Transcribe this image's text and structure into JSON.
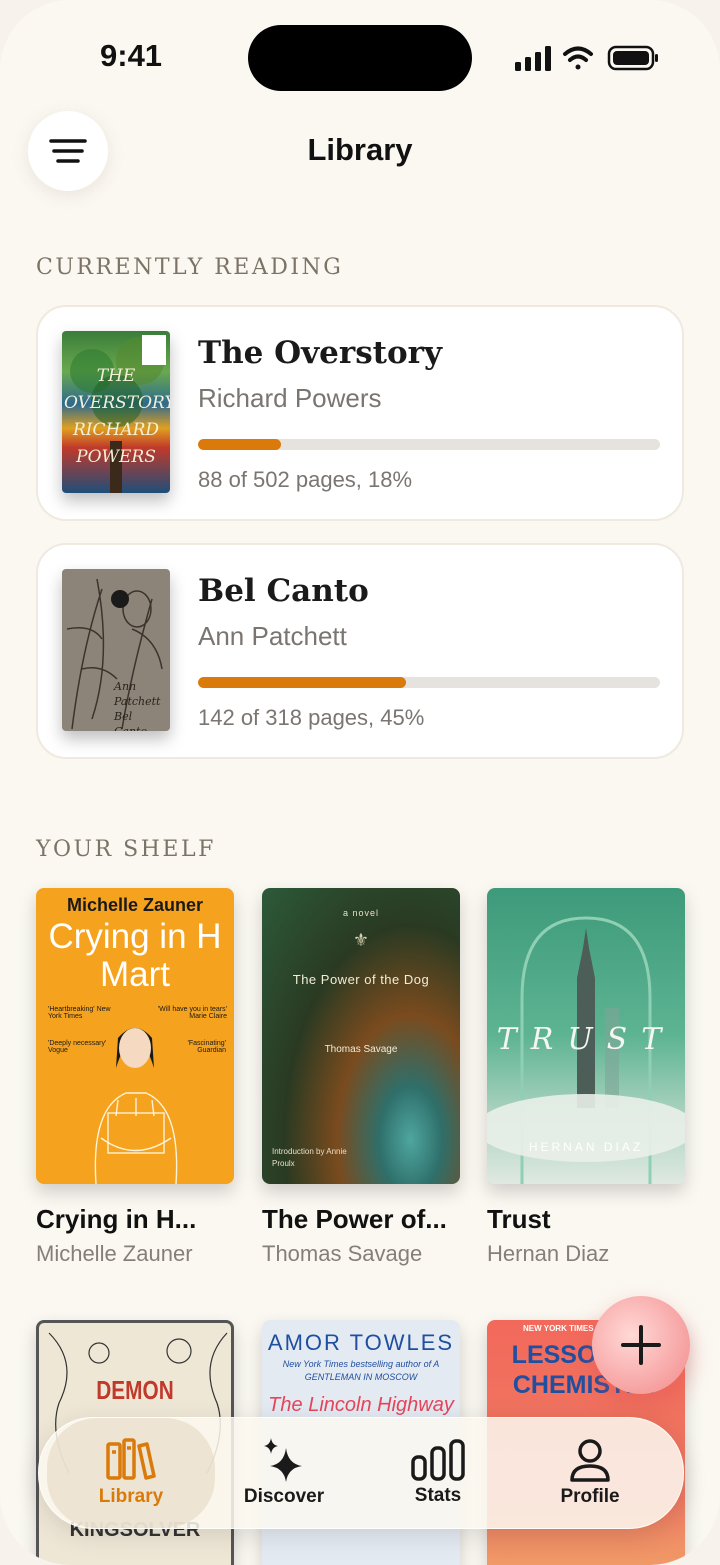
{
  "status": {
    "time": "9:41"
  },
  "header": {
    "title": "Library",
    "menu_icon": "hamburger-icon"
  },
  "currently_reading": {
    "label": "CURRENTLY READING",
    "books": [
      {
        "title": "The Overstory",
        "author": "Richard Powers",
        "progress": 0.18,
        "pages": "88 of 502 pages, 18%",
        "cover_text": "THE OVERSTORY RICHARD POWERS"
      },
      {
        "title": "Bel Canto",
        "author": "Ann Patchett",
        "progress": 0.45,
        "pages": "142 of 318 pages, 45%",
        "cover_text": "Ann Patchett Bel Canto"
      }
    ]
  },
  "shelf": {
    "label": "YOUR SHELF",
    "books": [
      {
        "title": "Crying in H...",
        "author": "Michelle Zauner",
        "cover_author": "Michelle Zauner",
        "cover_title": "Crying in H Mart",
        "cover_quotes": [
          "'Heartbreaking' New York Times",
          "'Will have you in tears' Marie Claire",
          "'Deeply necessary' Vogue",
          "'Fascinating' Guardian"
        ]
      },
      {
        "title": "The Power of...",
        "author": "Thomas Savage",
        "cover_kicker": "a novel",
        "cover_title": "The Power of the Dog",
        "cover_author": "Thomas Savage",
        "cover_note": "Introduction by Annie Proulx"
      },
      {
        "title": "Trust",
        "author": "Hernan Diaz",
        "cover_title": "TRUST",
        "cover_author": "HERNAN DIAZ"
      }
    ],
    "row2": [
      {
        "cover_title": "DEMON",
        "cover_author": "KINGSOLVER"
      },
      {
        "cover_author": "AMOR TOWLES",
        "cover_sub": "New York Times bestselling author of A GENTLEMAN IN MOSCOW",
        "cover_title": "The Lincoln Highway"
      },
      {
        "cover_kicker": "NEW YORK TIMES",
        "cover_title": "LESSONS in CHEMISTRY"
      }
    ]
  },
  "tabs": [
    {
      "label": "Library",
      "icon": "books-icon",
      "active": true
    },
    {
      "label": "Discover",
      "icon": "sparkle-icon",
      "active": false
    },
    {
      "label": "Stats",
      "icon": "bars-icon",
      "active": false
    },
    {
      "label": "Profile",
      "icon": "person-icon",
      "active": false
    }
  ],
  "colors": {
    "accent": "#d97a0a",
    "background": "#fbf8f2"
  }
}
